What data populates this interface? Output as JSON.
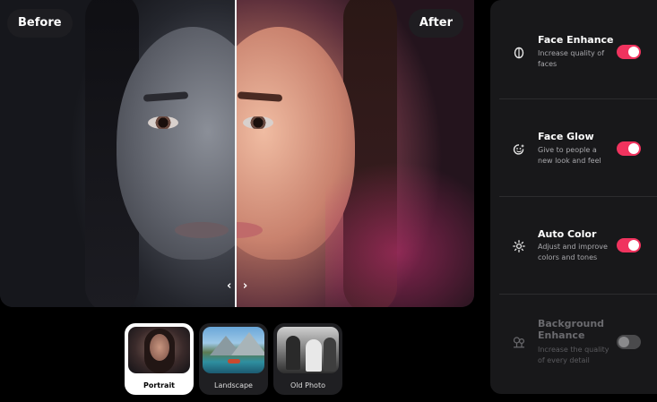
{
  "preview": {
    "before_label": "Before",
    "after_label": "After",
    "split_handle": "‹ ›",
    "split_position": 0.5
  },
  "presets": [
    {
      "label": "Portrait",
      "selected": true
    },
    {
      "label": "Landscape",
      "selected": false
    },
    {
      "label": "Old Photo",
      "selected": false
    }
  ],
  "settings": [
    {
      "icon": "face-enhance-icon",
      "title": "Face Enhance",
      "description": "Increase quality of faces",
      "enabled": true
    },
    {
      "icon": "face-glow-icon",
      "title": "Face Glow",
      "description": "Give to people a new look and feel",
      "enabled": true
    },
    {
      "icon": "auto-color-icon",
      "title": "Auto Color",
      "description": "Adjust and improve colors and tones",
      "enabled": true
    },
    {
      "icon": "background-enhance-icon",
      "title": "Background Enhance",
      "description": "Increase the quality of every detail",
      "enabled": false
    }
  ],
  "colors": {
    "accent": "#f0335e",
    "panel": "#18181a",
    "background": "#000000"
  }
}
